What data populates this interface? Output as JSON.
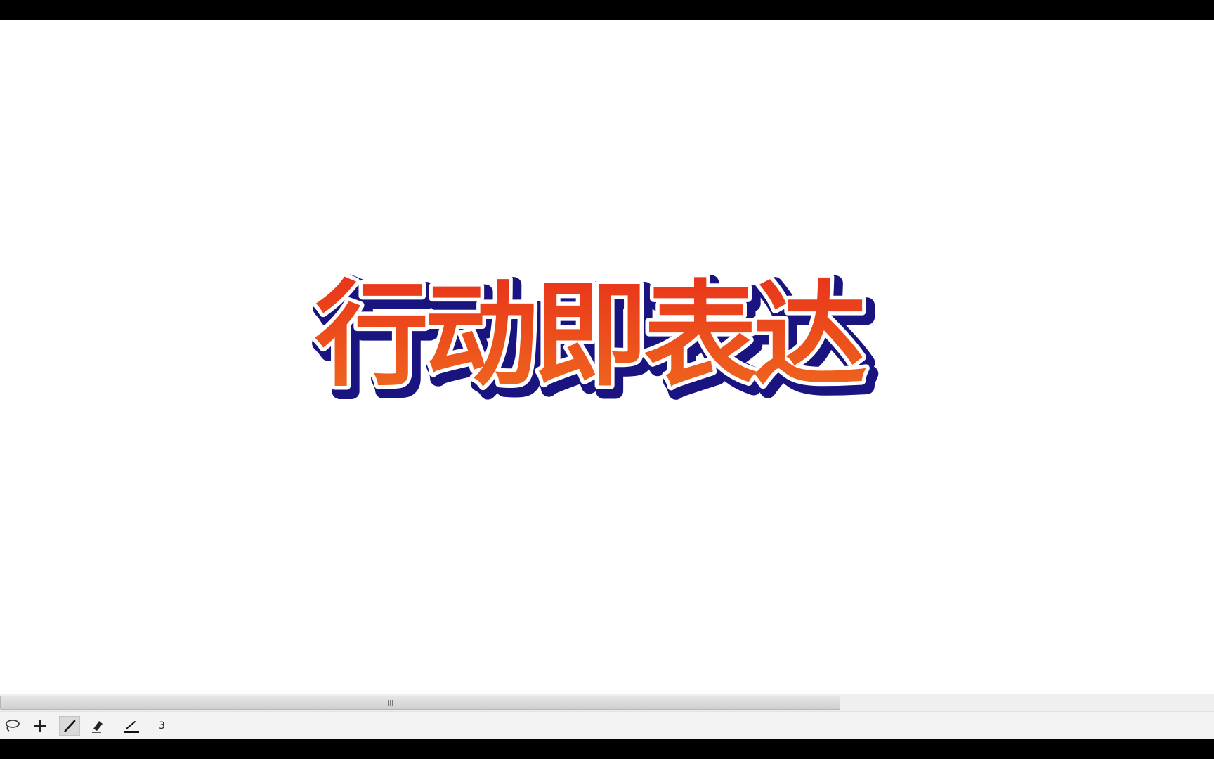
{
  "canvas": {
    "title_text": "行动即表达",
    "colors": {
      "fill_top": "#e8321a",
      "fill_bottom": "#f06a1e",
      "inner_outline": "#ffffff",
      "outer_outline": "#1a1480",
      "background": "#ffffff"
    }
  },
  "toolbar": {
    "tools": [
      {
        "name": "lasso-tool",
        "icon": "lasso-icon",
        "active": false
      },
      {
        "name": "crosshair-tool",
        "icon": "crosshair-icon",
        "active": false
      },
      {
        "name": "brush-tool",
        "icon": "brush-icon",
        "active": true
      },
      {
        "name": "eraser-tool",
        "icon": "eraser-icon",
        "active": false
      },
      {
        "name": "pen-tool",
        "icon": "pen-icon",
        "active": false
      }
    ],
    "stroke_size": "3"
  }
}
